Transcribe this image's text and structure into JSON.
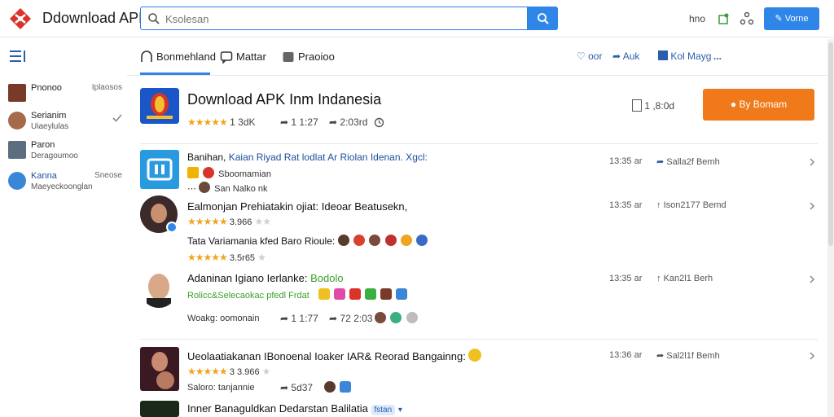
{
  "topbar": {
    "title": "Ddownload APK",
    "search_placeholder": "Ksolesan",
    "label": "hno",
    "button_label": "Vorne"
  },
  "sidebar": {
    "items": [
      {
        "name": "Pnonoo",
        "sub": "",
        "right": "Iplaosos"
      },
      {
        "name": "Serianim",
        "sub": "Uiaeylulas",
        "right": ""
      },
      {
        "name": "Paron",
        "sub": "Deragoumoo",
        "right": ""
      },
      {
        "name": "Kanna",
        "sub": "Maeyeckoonglan",
        "right": "Sneose"
      }
    ]
  },
  "tabs": [
    {
      "label": "Bonmehland"
    },
    {
      "label": "Mattar"
    },
    {
      "label": "Praoioo"
    }
  ],
  "actions": {
    "a1": "oor",
    "a2": "Auk",
    "a3": "Kol Mayg",
    "more": "..."
  },
  "header": {
    "title": "Download APK Inm Indanesia",
    "rating": "1 3dK",
    "shares": "1 1:27",
    "reposts": "2:03rd",
    "count": "1 ,8:0d",
    "download_label": "By Bomam",
    "stars_full": 5
  },
  "rows": [
    {
      "title_a": "Banihan,",
      "title_b": "Kaian Riyad Rat lodlat Ar Riolan Idenan. Xgcl:",
      "sub1": "Sboomamian",
      "sub2": "San Nalko nk",
      "time": "13:35 ar",
      "act": "Salla2f Bemh"
    },
    {
      "title": "Ealmonjan Prehiatakin ojiat: Ideoar Beatusekn,",
      "rating": "3.966",
      "line2": "Tata Variamania kfed Baro Rioule:",
      "count2": "3.5r65",
      "time": "13:35 ar",
      "act": "Ison2177 Bemd",
      "stars": 5
    },
    {
      "title_a": "Adaninan Igiano Ierlanke:",
      "title_b": "Bodolo",
      "sub": "Rolicc&Selecaokac pfedl Frdat",
      "line3": "Woakg: oomonain",
      "shares": "1 1:77",
      "reposts": "72 2:03",
      "time": "13:35 ar",
      "act": "Kan2l1 Berh"
    },
    {
      "title": "Ueolaatiakanan IBonoenal Ioaker IAR& Reorad Bangainng:",
      "rating": "3 3.966",
      "sub": "Saloro: tanjannie",
      "shares": "5d37",
      "time": "13:36 ar",
      "act": "Sal2l1f Bemh",
      "stars": 5
    },
    {
      "title": "Inner Banaguldkan Dedarstan Balilatia",
      "badge": "fstan"
    }
  ],
  "colors": {
    "accent": "#2f86e8",
    "download": "#f07a1a",
    "star": "#f0a520"
  }
}
